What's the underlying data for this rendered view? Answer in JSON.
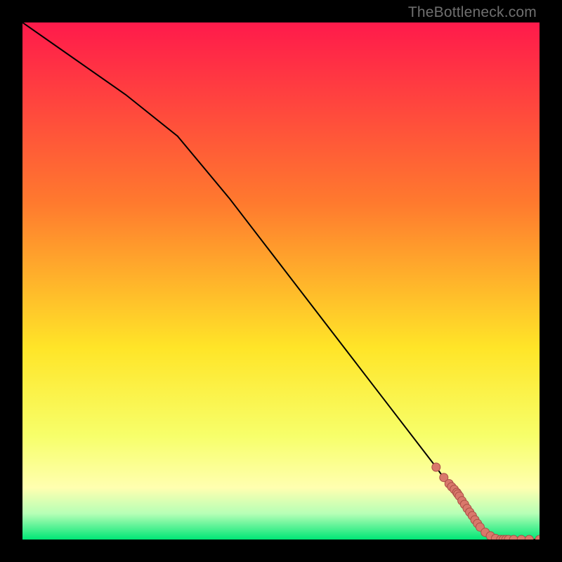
{
  "watermark": "TheBottleneck.com",
  "colors": {
    "gradient_top": "#ff1a4b",
    "gradient_mid_upper": "#ff7a2e",
    "gradient_mid": "#ffe528",
    "gradient_mid_lower": "#f7ff6a",
    "gradient_lower_yellow": "#ffffb0",
    "gradient_green_light": "#b6ffb6",
    "gradient_green": "#00e676",
    "line": "#000000",
    "marker_fill": "#d9786b",
    "marker_stroke": "#aa4e45"
  },
  "chart_data": {
    "type": "line",
    "title": "",
    "xlabel": "",
    "ylabel": "",
    "xlim": [
      0,
      100
    ],
    "ylim": [
      0,
      100
    ],
    "series": [
      {
        "name": "curve",
        "x": [
          0,
          10,
          20,
          30,
          40,
          50,
          60,
          70,
          80,
          85,
          88,
          90,
          92,
          94,
          96,
          98,
          100
        ],
        "y": [
          100,
          93,
          86,
          78,
          66,
          53,
          40,
          27,
          14,
          7,
          3,
          1,
          0,
          0,
          0,
          0,
          0
        ]
      }
    ],
    "markers": {
      "name": "data-points",
      "x": [
        80,
        81.5,
        82.5,
        83,
        83.5,
        84,
        84.2,
        84.5,
        85,
        85.5,
        86,
        86.5,
        87,
        87.5,
        88,
        88.5,
        89.5,
        90.5,
        91.5,
        92.5,
        93,
        93.5,
        94,
        95,
        96.5,
        98,
        100
      ],
      "y": [
        14,
        12,
        10.8,
        10.2,
        9.7,
        9.1,
        8.8,
        8.4,
        7.5,
        6.8,
        6,
        5.3,
        4.6,
        3.8,
        3.1,
        2.4,
        1.4,
        0.7,
        0.2,
        0,
        0,
        0,
        0,
        0,
        0,
        0,
        0
      ]
    }
  }
}
